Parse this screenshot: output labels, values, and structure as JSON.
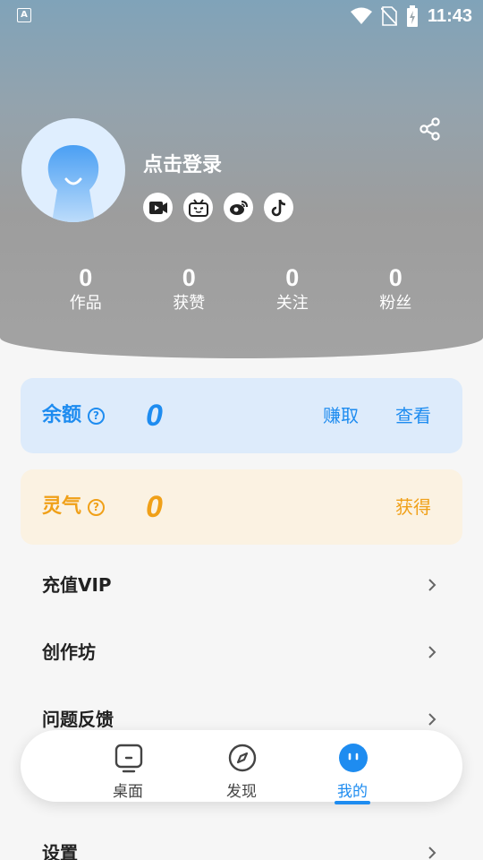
{
  "status_bar": {
    "left_icon_text": "A",
    "time": "11:43"
  },
  "profile": {
    "login_prompt": "点击登录",
    "social_icons": [
      "video-icon",
      "bilibili-icon",
      "weibo-icon",
      "douyin-icon"
    ]
  },
  "stats": [
    {
      "value": "0",
      "label": "作品"
    },
    {
      "value": "0",
      "label": "获赞"
    },
    {
      "value": "0",
      "label": "关注"
    },
    {
      "value": "0",
      "label": "粉丝"
    }
  ],
  "balance": {
    "title": "余额",
    "help": "?",
    "value": "0",
    "earn_label": "赚取",
    "view_label": "查看",
    "color": "#1e8cf0"
  },
  "aura": {
    "title": "灵气",
    "help": "?",
    "value": "0",
    "obtain_label": "获得",
    "color": "#f0a018"
  },
  "menu": [
    {
      "label": "充值VIP"
    },
    {
      "label": "创作坊"
    },
    {
      "label": "问题反馈"
    },
    {
      "label": "设置"
    }
  ],
  "tabbar": {
    "tabs": [
      {
        "label": "桌面",
        "icon": "desktop-icon"
      },
      {
        "label": "发现",
        "icon": "compass-icon"
      },
      {
        "label": "我的",
        "icon": "profile-face-icon"
      }
    ],
    "active_index": 2,
    "accent": "#1e8cf0"
  }
}
